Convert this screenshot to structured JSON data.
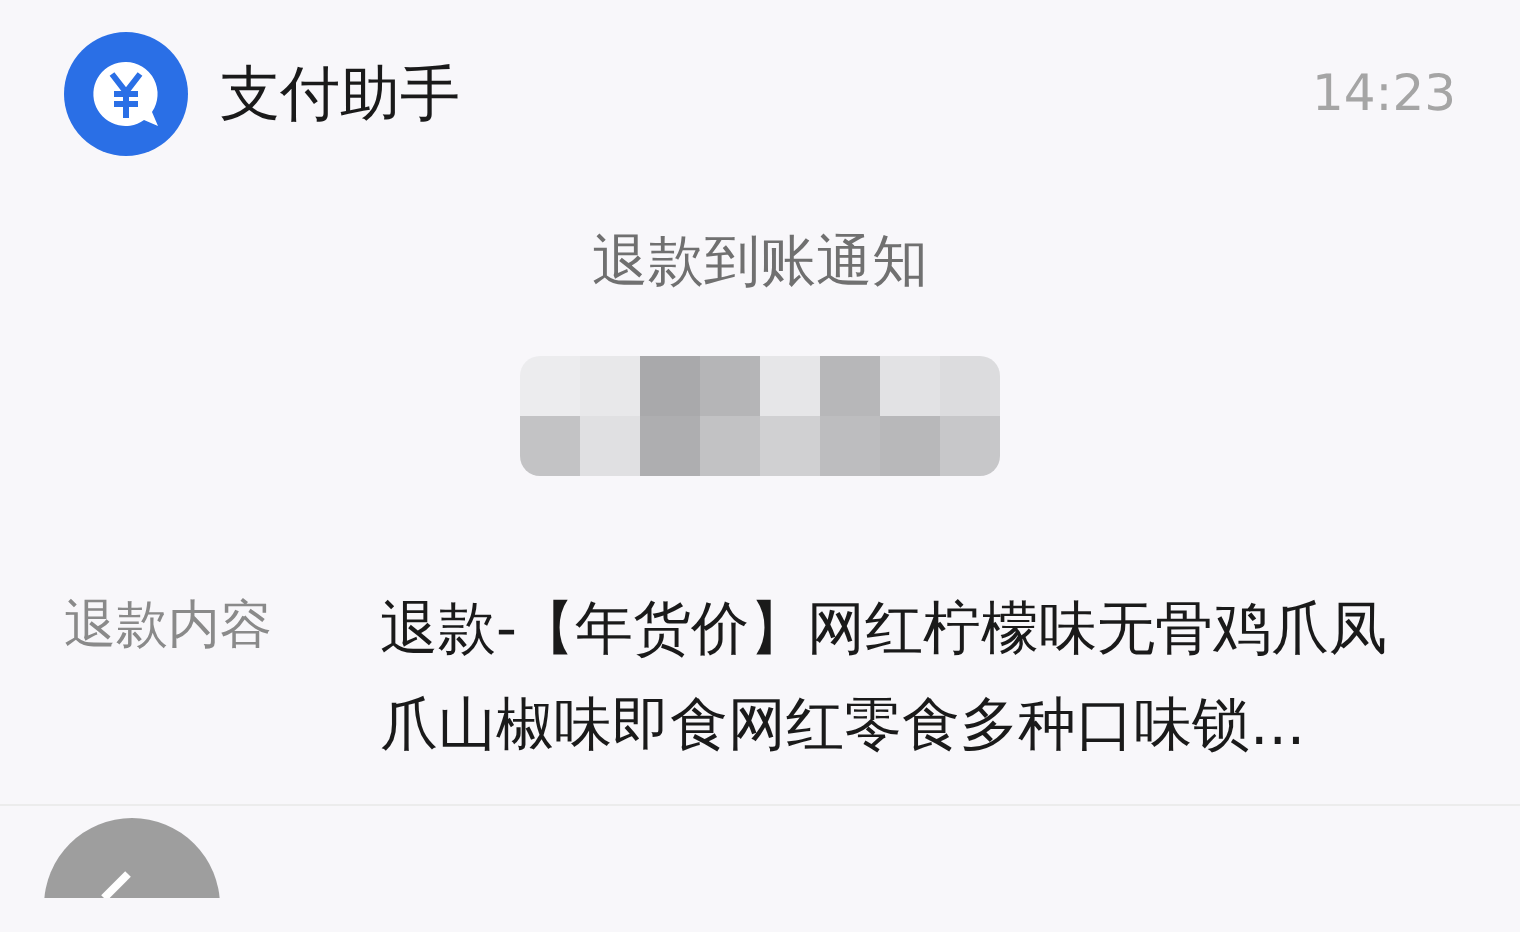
{
  "header": {
    "app_name": "支付助手",
    "time": "14:23"
  },
  "notice": {
    "title": "退款到账通知",
    "amount": {
      "kind": "redacted"
    }
  },
  "details": [
    {
      "label": "退款内容",
      "value": "退款-【年货价】网红柠檬味无骨鸡爪凤爪山椒味即食网红零食多种口味锁..."
    }
  ]
}
